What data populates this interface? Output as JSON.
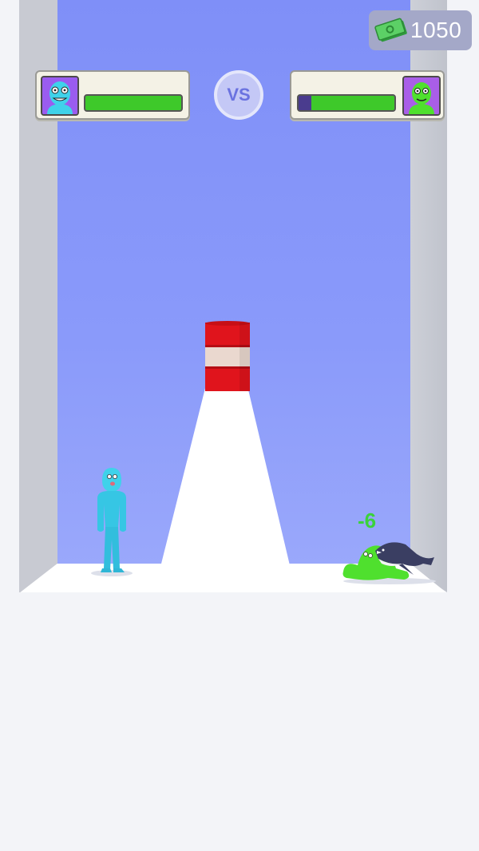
{
  "currency": {
    "amount": "1050",
    "icon": "cash-icon"
  },
  "versus": {
    "label": "VS"
  },
  "player": {
    "name": "player",
    "health_fraction": 1.0,
    "avatar_icon": "blue-monster-avatar-icon"
  },
  "opponent": {
    "name": "opponent",
    "health_fraction": 0.87,
    "avatar_icon": "green-monster-avatar-icon"
  },
  "effects": {
    "damage_popup": "-6"
  },
  "colors": {
    "sky": "#8393f9",
    "health_green": "#3ec92a",
    "health_empty": "#4a3c8e",
    "player_body": "#3fd2ea",
    "enemy_body": "#4fe02e",
    "barrel_red": "#e0141c"
  }
}
